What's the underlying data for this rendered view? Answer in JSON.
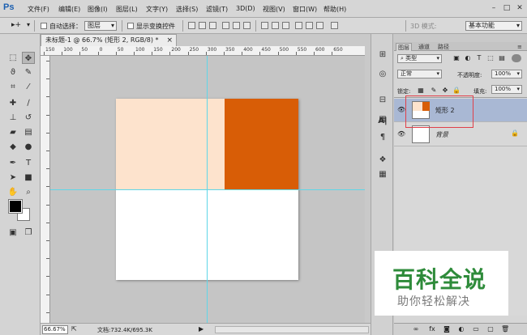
{
  "app": {
    "logo": "Ps"
  },
  "menu": [
    "文件(F)",
    "编辑(E)",
    "图像(I)",
    "图层(L)",
    "文字(Y)",
    "选择(S)",
    "滤镜(T)",
    "3D(D)",
    "视图(V)",
    "窗口(W)",
    "帮助(H)"
  ],
  "options": {
    "auto_select_label": "自动选择：",
    "auto_select_value": "图层",
    "transform_label": "显示变换控件",
    "mode3d": "3D 模式:",
    "workspace": "基本功能"
  },
  "document": {
    "tab_title": "未标题-1 @ 66.7% (矩形 2, RGB/8) *",
    "close": "×",
    "colors": {
      "peach": "#fde3cd",
      "orange": "#d85d06",
      "guide": "#5fd6e8"
    }
  },
  "ruler": {
    "top_labels": [
      "150",
      "100",
      "50",
      "0",
      "50",
      "100",
      "150",
      "200",
      "250",
      "300",
      "350",
      "400",
      "450",
      "500",
      "550",
      "600",
      "650"
    ]
  },
  "status": {
    "zoom": "66.67%",
    "doc_info": "文档:732.4K/695.3K",
    "arrow": "▶"
  },
  "layers_panel": {
    "tabs": [
      "图层",
      "通道",
      "路径"
    ],
    "filter_label": "类型",
    "blend_mode": "正常",
    "opacity_label": "不透明度:",
    "opacity_value": "100%",
    "lock_label": "锁定:",
    "fill_label": "填充:",
    "fill_value": "100%",
    "layers": [
      {
        "name": "矩形 2",
        "selected": true
      },
      {
        "name": "背景",
        "locked": true
      }
    ]
  },
  "watermark": {
    "title": "百科全说",
    "subtitle": "助你轻松解决"
  }
}
